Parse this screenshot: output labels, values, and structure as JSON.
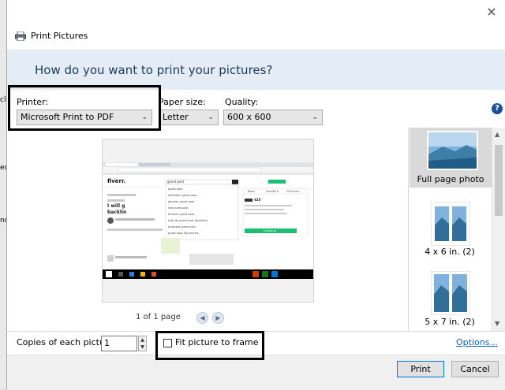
{
  "window": {
    "title": "Print Pictures",
    "close_glyph": "×"
  },
  "header": {
    "question": "How do you want to print your pictures?"
  },
  "printer": {
    "label": "Printer:",
    "value": "Microsoft Print to PDF"
  },
  "paper_size": {
    "label": "Paper size:",
    "value": "Letter"
  },
  "quality": {
    "label": "Quality:",
    "value": "600 x 600"
  },
  "help": {
    "glyph": "?"
  },
  "preview": {
    "page_info": "1 of 1 page"
  },
  "layouts": [
    {
      "label": "Full page photo",
      "selected": true
    },
    {
      "label": "4 x 6 in. (2)",
      "selected": false
    },
    {
      "label": "5 x 7 in. (2)",
      "selected": false
    }
  ],
  "copies": {
    "label": "Copies of each picture:",
    "value": "1"
  },
  "fit": {
    "label": "Fit picture to frame",
    "checked": false
  },
  "options": {
    "label": "Options..."
  },
  "buttons": {
    "print": "Print",
    "cancel": "Cancel"
  },
  "colors": {
    "header_bg": "#e4edf6",
    "header_text": "#1e395b",
    "link": "#0066cc",
    "taskbar": "#000000"
  },
  "icons": {
    "printer": "printer-icon",
    "help": "help-icon",
    "prev": "chevron-left-icon",
    "next": "chevron-right-icon"
  },
  "background_fragments": [
    "cl",
    "ec",
    "no"
  ],
  "preview_screenshot": {
    "site_logo": "fiverr.",
    "search_text": "guest post",
    "suggestions": [
      "guest post",
      "definition guest post",
      "german guest post",
      "seo guest post",
      "tourism guest post",
      "high da guest post backlinks",
      "business guest post",
      "guest post big service"
    ],
    "tab_labels": [
      "Basic",
      "Standard",
      "Premium"
    ],
    "price": "$25",
    "continue": "Continue",
    "headline": "I will g",
    "headline2": "backlin"
  }
}
